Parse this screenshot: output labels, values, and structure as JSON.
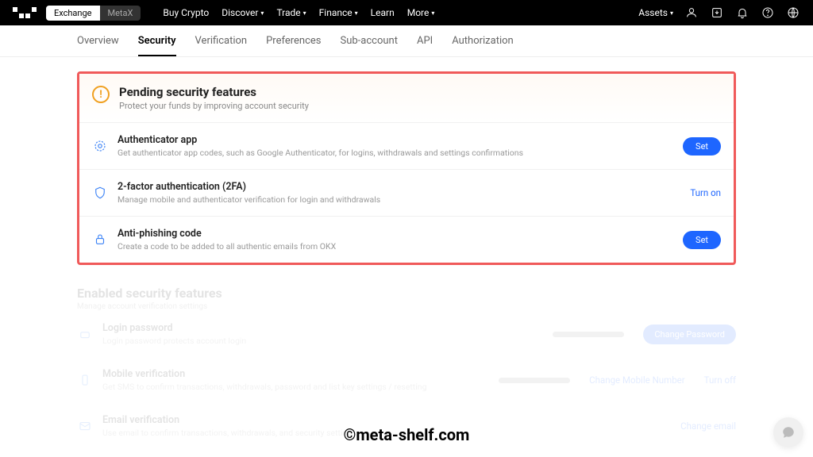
{
  "nav": {
    "mode_exchange": "Exchange",
    "mode_metax": "MetaX",
    "links": {
      "buy": "Buy Crypto",
      "discover": "Discover",
      "trade": "Trade",
      "finance": "Finance",
      "learn": "Learn",
      "more": "More"
    },
    "assets": "Assets"
  },
  "tabs": {
    "overview": "Overview",
    "security": "Security",
    "verification": "Verification",
    "preferences": "Preferences",
    "subaccount": "Sub-account",
    "api": "API",
    "authorization": "Authorization"
  },
  "pending": {
    "title": "Pending security features",
    "subtitle": "Protect your funds by improving account security",
    "items": [
      {
        "title": "Authenticator app",
        "desc": "Get authenticator app codes, such as Google Authenticator, for logins, withdrawals and settings confirmations",
        "action": "Set",
        "action_type": "button"
      },
      {
        "title": "2-factor authentication (2FA)",
        "desc": "Manage mobile and authenticator verification for login and withdrawals",
        "action": "Turn on",
        "action_type": "link"
      },
      {
        "title": "Anti-phishing code",
        "desc": "Create a code to be added to all authentic emails from OKX",
        "action": "Set",
        "action_type": "button"
      }
    ]
  },
  "enabled": {
    "title": "Enabled security features",
    "subtitle": "Manage account verification settings",
    "items": [
      {
        "title": "Login password",
        "desc": "Login password protects account login",
        "action": "Change Password"
      },
      {
        "title": "Mobile verification",
        "desc": "Get SMS to confirm transactions, withdrawals, password and list key settings / resetting",
        "action": "Change Mobile Number",
        "action2": "Turn off"
      },
      {
        "title": "Email verification",
        "desc": "Use email to confirm transactions, withdrawals, and security settings",
        "action": "Change email"
      }
    ]
  },
  "watermark": "©meta-shelf.com"
}
